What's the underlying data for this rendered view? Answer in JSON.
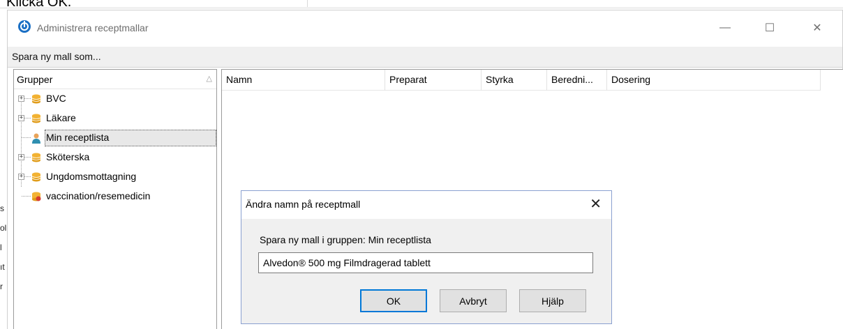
{
  "caption": "Klicka OK.",
  "window": {
    "title": "Administrera receptmallar",
    "controls": {
      "minimize": "—",
      "maximize": "☐",
      "close": "✕"
    }
  },
  "toolbar": {
    "save_as_label": "Spara ny mall som..."
  },
  "tree": {
    "header": "Grupper",
    "sort_indicator": "△",
    "items": [
      {
        "label": "BVC",
        "icon": "database-icon",
        "expandable": true,
        "selected": false
      },
      {
        "label": "Läkare",
        "icon": "database-icon",
        "expandable": true,
        "selected": false
      },
      {
        "label": "Min receptlista",
        "icon": "user-icon",
        "expandable": false,
        "selected": true
      },
      {
        "label": "Sköterska",
        "icon": "database-icon",
        "expandable": true,
        "selected": false
      },
      {
        "label": "Ungdomsmottagning",
        "icon": "database-icon",
        "expandable": true,
        "selected": false
      },
      {
        "label": "vaccination/resemedicin",
        "icon": "database-alert-icon",
        "expandable": false,
        "selected": false
      }
    ]
  },
  "list": {
    "columns": [
      "Namn",
      "Preparat",
      "Styrka",
      "Beredni...",
      "Dosering"
    ]
  },
  "dialog": {
    "title": "Ändra namn på receptmall",
    "close": "✕",
    "label": "Spara ny mall i gruppen: Min receptlista",
    "input_value": "Alvedon® 500 mg Filmdragerad tablett",
    "ok_label": "OK",
    "cancel_label": "Avbryt",
    "help_label": "Hjälp"
  },
  "background_fragments": [
    "s",
    "ol",
    "l",
    "ıt",
    "r"
  ],
  "colors": {
    "accent": "#0078d7",
    "db_icon": "#f2b233",
    "dialog_border": "#8aa0d0"
  }
}
